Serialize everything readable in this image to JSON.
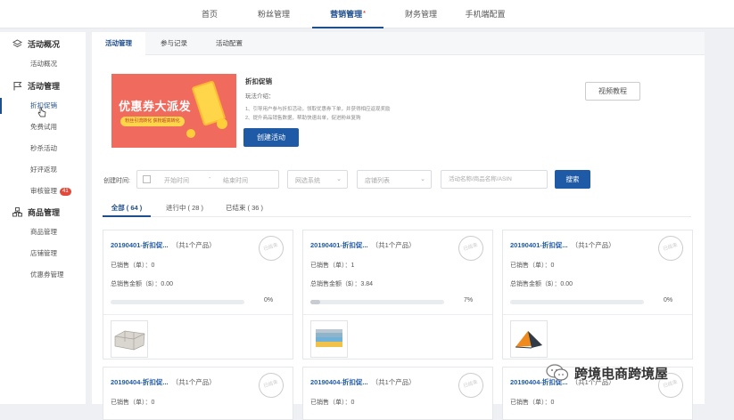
{
  "topnav": {
    "tabs": [
      {
        "label": "首页"
      },
      {
        "label": "粉丝管理"
      },
      {
        "label": "营销管理",
        "active": true,
        "dot": "*"
      },
      {
        "label": "财务管理"
      },
      {
        "label": "手机端配置"
      }
    ]
  },
  "sidebar": {
    "groups": [
      {
        "label": "活动概况",
        "icon": "layers-icon",
        "items": [
          "活动概况"
        ]
      },
      {
        "label": "活动管理",
        "icon": "flag-icon",
        "items": [
          "折扣促销",
          "免费试用",
          "秒杀活动",
          "好评返现",
          "审核管理"
        ],
        "active_item": "折扣促销",
        "badge": "41"
      },
      {
        "label": "商品管理",
        "icon": "cluster-icon",
        "items": [
          "商品管理",
          "店铺管理",
          "优惠券管理"
        ]
      }
    ]
  },
  "subtabs": [
    "活动管理",
    "参与记录",
    "活动配置"
  ],
  "banner": {
    "title": "优惠券大派发",
    "subtitle": "粉丝引流转化 获粉超高转化"
  },
  "intro": {
    "title": "折扣促销",
    "label": "玩法介绍：",
    "lines": [
      "1、引导用户参与折扣活动，领取优惠券下单，并获得相应返现奖励",
      "2、提升商品销售数据，帮助快速出单，促进粉丝复购"
    ],
    "create_button": "创建活动",
    "video_button": "视频教程"
  },
  "filters": {
    "label": "创建时间:",
    "start_placeholder": "开始时间",
    "end_placeholder": "结束时间",
    "site_placeholder": "网选系统",
    "shop_placeholder": "店铺列表",
    "search_placeholder": "活动名称/商品名称/ASIN",
    "search_button": "搜索"
  },
  "status_tabs": [
    {
      "label": "全部 ( 64 )",
      "active": true
    },
    {
      "label": "进行中 ( 28 )"
    },
    {
      "label": "已结束 ( 36 )"
    }
  ],
  "cards_top": [
    {
      "title": "20190401-折扣促...",
      "sub": "（共1个产品）",
      "stamp": "已结束",
      "sold_label": "已销售（单）：0",
      "amount_label": "总销售金额（$）：0.00",
      "progress": 0,
      "progress_text": "0%",
      "thumb": "tile-product"
    },
    {
      "title": "20190401-折扣促...",
      "sub": "（共1个产品）",
      "stamp": "已结束",
      "sold_label": "已销售（单）：1",
      "amount_label": "总销售金额（$）：3.84",
      "progress": 7,
      "progress_text": "7%",
      "thumb": "towel-product"
    },
    {
      "title": "20190401-折扣促...",
      "sub": "（共1个产品）",
      "stamp": "已结束",
      "sold_label": "已销售（单）：0",
      "amount_label": "总销售金额（$）：0.00",
      "progress": 0,
      "progress_text": "0%",
      "thumb": "tent-product"
    }
  ],
  "cards_bottom": [
    {
      "title": "20190404-折扣促...",
      "sub": "（共1个产品）",
      "stamp": "已结束",
      "sold_label": "已销售（单）：0"
    },
    {
      "title": "20190404-折扣促...",
      "sub": "（共1个产品）",
      "stamp": "已结束",
      "sold_label": "已销售（单）：0"
    },
    {
      "title": "20190404-折扣促...",
      "sub": "（共1个产品）",
      "stamp": "已结束",
      "sold_label": "已销售（单）：0"
    }
  ],
  "watermark": {
    "text": "跨境电商跨境屋"
  },
  "colors": {
    "accent": "#1f5aa6",
    "banner": "#f06b5e",
    "badge": "#e24a3b"
  }
}
